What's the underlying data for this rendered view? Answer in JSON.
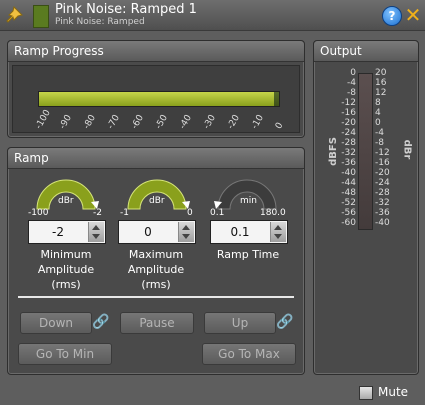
{
  "window": {
    "title": "Pink Noise: Ramped 1",
    "subtitle": "Pink Noise: Ramped",
    "swatch_color": "#5a7b20"
  },
  "ramp_progress": {
    "title": "Ramp Progress",
    "progress_fraction": 0.98,
    "ticks": [
      "-100",
      "-90",
      "-80",
      "-70",
      "-60",
      "-50",
      "-40",
      "-30",
      "-20",
      "-10",
      "0"
    ]
  },
  "ramp": {
    "title": "Ramp",
    "knobs": [
      {
        "unit": "dBr",
        "min": "-100",
        "max": "-2",
        "value": "-2",
        "label1": "Minimum",
        "label2": "Amplitude",
        "label3": "(rms)",
        "accent": "#8aa01c"
      },
      {
        "unit": "dBr",
        "min": "-1",
        "max": "0",
        "value": "0",
        "label1": "Maximum",
        "label2": "Amplitude",
        "label3": "(rms)",
        "accent": "#8aa01c"
      },
      {
        "unit": "min",
        "min": "0.1",
        "max": "180.0",
        "value": "0.1",
        "label1": "Ramp Time",
        "label2": "",
        "label3": "",
        "accent": "#444444"
      }
    ],
    "buttons": {
      "down": "Down",
      "pause": "Pause",
      "up": "Up",
      "go_to_min": "Go To Min",
      "go_to_max": "Go To Max"
    }
  },
  "output": {
    "title": "Output",
    "dbfs_label": "dBFS",
    "dbr_label": "dBr",
    "dbfs_scale": [
      "0",
      "-4",
      "-8",
      "-12",
      "-16",
      "-20",
      "-24",
      "-28",
      "-32",
      "-36",
      "-40",
      "-44",
      "-48",
      "-52",
      "-56",
      "-60"
    ],
    "dbr_scale": [
      "20",
      "16",
      "12",
      "8",
      "4",
      "0",
      "-4",
      "-8",
      "-12",
      "-16",
      "-20",
      "-24",
      "-28",
      "-32",
      "-36",
      "-40"
    ]
  },
  "footer": {
    "mute_label": "Mute"
  }
}
